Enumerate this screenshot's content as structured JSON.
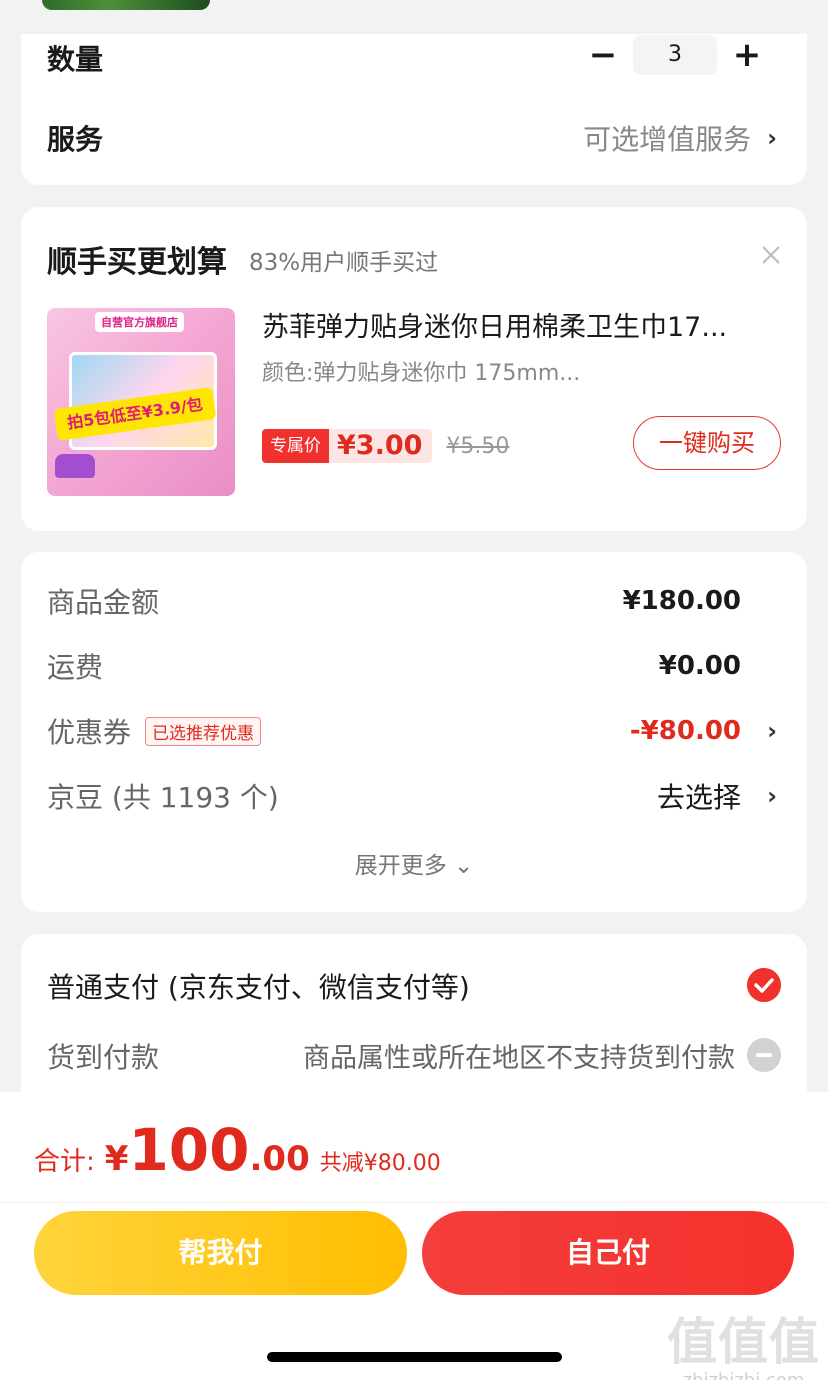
{
  "quantity_card": {
    "qty_label": "数量",
    "qty_minus": "−",
    "qty_value": "3",
    "qty_plus": "+",
    "service_label": "服务",
    "service_value": "可选增值服务",
    "chevron": "›"
  },
  "recommend_card": {
    "title": "顺手买更划算",
    "subtitle": "83%用户顺手买过",
    "product": {
      "image_badge": "自营官方旗舰店",
      "image_promo": "拍5包低至¥3.9/包",
      "name": "苏菲弹力贴身迷你日用棉柔卫生巾17...",
      "attr": "颜色:弹力贴身迷你巾 175mm...",
      "price_tag": "专属价",
      "price": "¥3.00",
      "old_price": "¥5.50",
      "buy_button": "一键购买"
    }
  },
  "summary_card": {
    "rows": [
      {
        "label": "商品金额",
        "value": "¥180.00"
      },
      {
        "label": "运费",
        "value": "¥0.00"
      },
      {
        "label": "优惠券",
        "tag": "已选推荐优惠",
        "value": "-¥80.00"
      },
      {
        "label": "京豆 (共 1193 个)",
        "value": "去选择"
      }
    ],
    "expand": "展开更多 ⌄"
  },
  "payment_card": {
    "option1": "普通支付 (京东支付、微信支付等)",
    "cod_label": "货到付款",
    "cod_note": "商品属性或所在地区不支持货到付款"
  },
  "bottom_bar": {
    "total_label": "合计:",
    "currency": "¥",
    "total_int": "100",
    "total_dec": ".00",
    "reduce": "共减¥80.00",
    "btn_help": "帮我付",
    "btn_self": "自己付",
    "watermark": "值值值",
    "watermark_url": "zhizhizhi.com"
  },
  "colors": {
    "accent_red": "#e02a1e",
    "button_yellow": "#ffc400",
    "button_red": "#f4352f"
  }
}
